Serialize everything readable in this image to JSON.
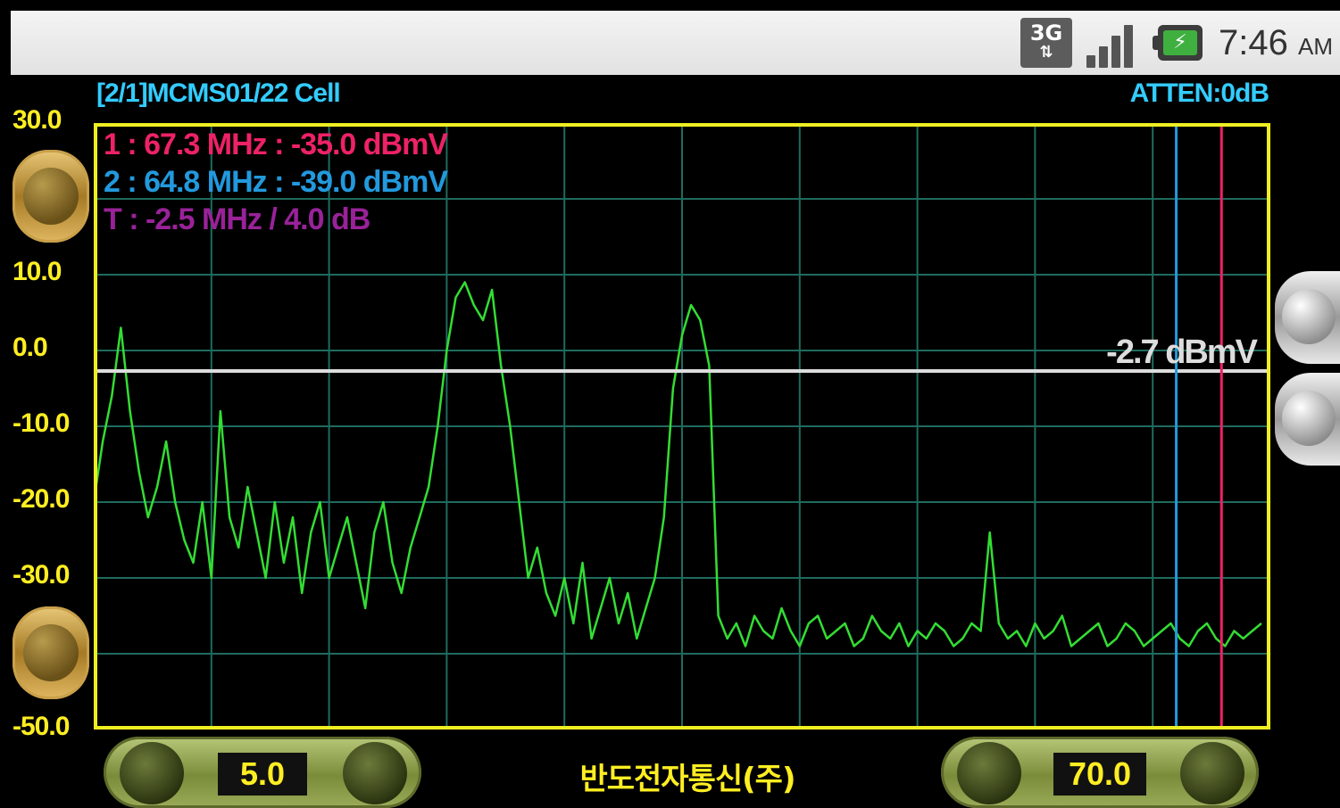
{
  "statusbar": {
    "network_type": "3G",
    "clock": "7:46",
    "ampm": "AM",
    "icons": [
      "3g-data-icon",
      "signal-strength-icon",
      "battery-charging-icon"
    ]
  },
  "header": {
    "title": "[2/1]MCMS01/22 Cell",
    "atten": "ATTEN:0dB"
  },
  "markers": {
    "m1": "1 : 67.3 MHz : -35.0 dBmV",
    "m2": "2 : 64.8 MHz : -39.0 dBmV",
    "delta": "T : -2.5 MHz / 4.0 dB"
  },
  "reference_level": "-2.7 dBmV",
  "colors": {
    "trace": "#33dd33",
    "grid": "#1f6b5e",
    "border": "#eeee22",
    "marker1": "#ee2266",
    "marker2": "#2299dd",
    "delta": "#992299",
    "reference_line": "#dddddd"
  },
  "controls": {
    "start_freq": "5.0",
    "stop_freq": "70.0"
  },
  "maker": "반도전자통신(주)",
  "chart_data": {
    "type": "line",
    "title": "",
    "xlabel": "",
    "ylabel": "",
    "xlim": [
      5.0,
      70.0
    ],
    "ylim": [
      -50,
      30
    ],
    "y_tick_labels": [
      "30.0",
      "10.0",
      "0.0",
      "-10.0",
      "-20.0",
      "-30.0",
      "-50.0"
    ],
    "y_tick_values": [
      30,
      10,
      0,
      -10,
      -20,
      -30,
      -50
    ],
    "grid": true,
    "reference_line_y": -2.7,
    "marker_lines_x": [
      64.8,
      67.3
    ],
    "series": [
      {
        "values_x": [
          5.0,
          5.5,
          6.0,
          6.5,
          7.0,
          7.5,
          8.0,
          8.5,
          9.0,
          9.5,
          10.0,
          10.5,
          11.0,
          11.5,
          12.0,
          12.5,
          13.0,
          13.5,
          14.0,
          14.5,
          15.0,
          15.5,
          16.0,
          16.5,
          17.0,
          17.5,
          18.0,
          18.5,
          19.0,
          19.5,
          20.0,
          20.5,
          21.0,
          21.5,
          22.0,
          22.5,
          23.0,
          23.5,
          24.0,
          24.5,
          25.0,
          25.5,
          26.0,
          26.5,
          27.0,
          27.5,
          28.0,
          28.5,
          29.0,
          29.5,
          30.0,
          30.5,
          31.0,
          31.5,
          32.0,
          32.5,
          33.0,
          33.5,
          34.0,
          34.5,
          35.0,
          35.5,
          36.0,
          36.5,
          37.0,
          37.5,
          38.0,
          38.5,
          39.0,
          39.5,
          40.0,
          40.5,
          41.0,
          41.5,
          42.0,
          42.5,
          43.0,
          43.5,
          44.0,
          44.5,
          45.0,
          45.5,
          46.0,
          46.5,
          47.0,
          47.5,
          48.0,
          48.5,
          49.0,
          49.5,
          50.0,
          50.5,
          51.0,
          51.5,
          52.0,
          52.5,
          53.0,
          53.5,
          54.0,
          54.5,
          55.0,
          55.5,
          56.0,
          56.5,
          57.0,
          57.5,
          58.0,
          58.5,
          59.0,
          59.5,
          60.0,
          60.5,
          61.0,
          61.5,
          62.0,
          62.5,
          63.0,
          63.5,
          64.0,
          64.5,
          65.0,
          65.5,
          66.0,
          66.5,
          67.0,
          67.5,
          68.0,
          68.5,
          69.0,
          69.5,
          70.0
        ],
        "values_y": [
          -20,
          -12,
          -6,
          3,
          -8,
          -16,
          -22,
          -18,
          -12,
          -20,
          -25,
          -28,
          -20,
          -30,
          -8,
          -22,
          -26,
          -18,
          -24,
          -30,
          -20,
          -28,
          -22,
          -32,
          -24,
          -20,
          -30,
          -26,
          -22,
          -28,
          -34,
          -24,
          -20,
          -28,
          -32,
          -26,
          -22,
          -18,
          -10,
          0,
          7,
          9,
          6,
          4,
          8,
          -2,
          -10,
          -20,
          -30,
          -26,
          -32,
          -35,
          -30,
          -36,
          -28,
          -38,
          -34,
          -30,
          -36,
          -32,
          -38,
          -34,
          -30,
          -22,
          -5,
          2,
          6,
          4,
          -2,
          -35,
          -38,
          -36,
          -39,
          -35,
          -37,
          -38,
          -34,
          -37,
          -39,
          -36,
          -35,
          -38,
          -37,
          -36,
          -39,
          -38,
          -35,
          -37,
          -38,
          -36,
          -39,
          -37,
          -38,
          -36,
          -37,
          -39,
          -38,
          -36,
          -37,
          -24,
          -36,
          -38,
          -37,
          -39,
          -36,
          -38,
          -37,
          -35,
          -39,
          -38,
          -37,
          -36,
          -39,
          -38,
          -36,
          -37,
          -39,
          -38,
          -37,
          -36,
          -38,
          -39,
          -37,
          -36,
          -38,
          -39,
          -37,
          -38,
          -37,
          -36
        ]
      }
    ]
  }
}
